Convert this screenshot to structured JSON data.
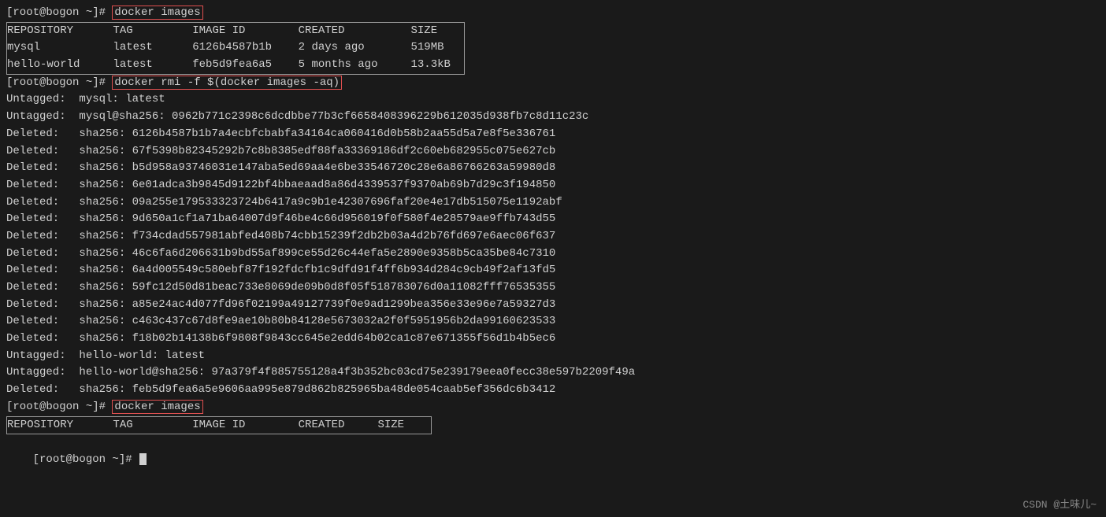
{
  "terminal": {
    "lines": [
      {
        "type": "prompt-cmd",
        "prompt": "[root@bogon ~]# ",
        "cmd": "docker images"
      },
      {
        "type": "table-header",
        "cols": "REPOSITORY      TAG         IMAGE ID        CREATED          SIZE"
      },
      {
        "type": "table-row",
        "content": "mysql           latest      6126b4587b1b    2 days ago       519MB"
      },
      {
        "type": "table-row-last",
        "content": "hello-world     latest      feb5d9fea6a5    5 months ago     13.3kB"
      },
      {
        "type": "prompt-cmd",
        "prompt": "[root@bogon ~]# ",
        "cmd": "docker rmi -f $(docker images -aq)"
      },
      {
        "type": "plain",
        "content": "Untagged:  mysql: latest"
      },
      {
        "type": "plain",
        "content": "Untagged:  mysql@sha256: 0962b771c2398c6dcdbbe77b3cf6658408396229b612035d938fb7c8d11c23c"
      },
      {
        "type": "plain",
        "content": "Deleted:   sha256: 6126b4587b1b7a4ecbfcbabfa34164ca060416d0b58b2aa55d5a7e8f5e336761"
      },
      {
        "type": "plain",
        "content": "Deleted:   sha256: 67f5398b82345292b7c8b8385edf88fa33369186df2c60eb682955c075e627cb"
      },
      {
        "type": "plain",
        "content": "Deleted:   sha256: b5d958a93746031e147aba5ed69aa4e6be33546720c28e6a86766263a59980d8"
      },
      {
        "type": "plain",
        "content": "Deleted:   sha256: 6e01adca3b9845d9122bf4bbaeaad8a86d4339537f9370ab69b7d29c3f194850"
      },
      {
        "type": "plain",
        "content": "Deleted:   sha256: 09a255e179533323724b6417a9c9b1e42307696faf20e4e17db515075e1192abf"
      },
      {
        "type": "plain",
        "content": "Deleted:   sha256: 9d650a1cf1a71ba64007d9f46be4c66d956019f0f580f4e28579ae9ffb743d55"
      },
      {
        "type": "plain",
        "content": "Deleted:   sha256: f734cdad557981abfed408b74cbb15239f2db2b03a4d2b76fd697e6aec06f637"
      },
      {
        "type": "plain",
        "content": "Deleted:   sha256: 46c6fa6d206631b9bd55af899ce55d26c44efa5e2890e9358b5ca35be84c7310"
      },
      {
        "type": "plain",
        "content": "Deleted:   sha256: 6a4d005549c580ebf87f192fdcfb1c9dfd91f4ff6b934d284c9cb49f2af13fd5"
      },
      {
        "type": "plain",
        "content": "Deleted:   sha256: 59fc12d50d81beac733e8069de09b0d8f05f518783076d0a11082fff76535355"
      },
      {
        "type": "plain",
        "content": "Deleted:   sha256: a85e24ac4d077fd96f02199a49127739f0e9ad1299bea356e33e96e7a59327d3"
      },
      {
        "type": "plain",
        "content": "Deleted:   sha256: c463c437c67d8fe9ae10b80b84128e5673032a2f0f5951956b2da99160623533"
      },
      {
        "type": "plain",
        "content": "Deleted:   sha256: f18b02b14138b6f9808f9843cc645e2edd64b02ca1c87e671355f56d1b4b5ec6"
      },
      {
        "type": "plain",
        "content": "Untagged:  hello-world: latest"
      },
      {
        "type": "plain",
        "content": "Untagged:  hello-world@sha256: 97a379f4f885755128a4f3b352bc03cd75e239179eea0fecc38e597b2209f49a"
      },
      {
        "type": "plain",
        "content": "Deleted:   sha256: feb5d9fea6a5e9606aa995e879d862b825965ba48de054caab5ef356dc6b3412"
      },
      {
        "type": "prompt-cmd2",
        "prompt": "[root@bogon ~]# ",
        "cmd": "docker images"
      },
      {
        "type": "table-header2",
        "cols": "REPOSITORY      TAG         IMAGE ID        CREATED     SIZE"
      },
      {
        "type": "last-prompt",
        "prompt": "[root@bogon ~]# "
      }
    ],
    "watermark": "CSDN @土味儿~"
  }
}
